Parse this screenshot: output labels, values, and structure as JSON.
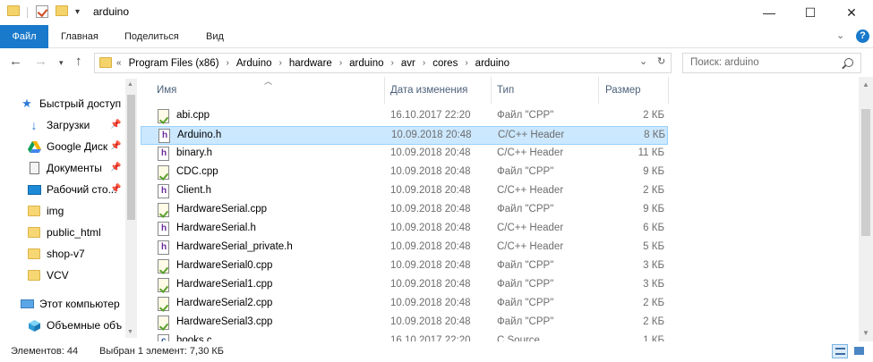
{
  "window": {
    "title": "arduino",
    "controls": {
      "minimize": "—",
      "maximize": "☐",
      "close": "✕"
    }
  },
  "ribbon": {
    "tabs": [
      "Файл",
      "Главная",
      "Поделиться",
      "Вид"
    ]
  },
  "address": {
    "overflow": "«",
    "crumbs": [
      "Program Files (x86)",
      "Arduino",
      "hardware",
      "arduino",
      "avr",
      "cores",
      "arduino"
    ]
  },
  "search": {
    "placeholder": "Поиск: arduino"
  },
  "navpane": {
    "items": [
      {
        "label": "Быстрый доступ",
        "icon": "star-icon",
        "pinned": false
      },
      {
        "label": "Загрузки",
        "icon": "download-icon",
        "pinned": true
      },
      {
        "label": "Google Диск",
        "icon": "google-drive-icon",
        "pinned": true
      },
      {
        "label": "Документы",
        "icon": "documents-icon",
        "pinned": true
      },
      {
        "label": "Рабочий сто...",
        "icon": "desktop-icon",
        "pinned": true
      },
      {
        "label": "img",
        "icon": "folder-icon",
        "pinned": false
      },
      {
        "label": "public_html",
        "icon": "folder-icon",
        "pinned": false
      },
      {
        "label": "shop-v7",
        "icon": "folder-icon",
        "pinned": false
      },
      {
        "label": "VCV",
        "icon": "folder-icon",
        "pinned": false
      },
      {
        "label": "Этот компьютер",
        "icon": "computer-icon",
        "pinned": false
      },
      {
        "label": "Объемные объ",
        "icon": "3d-objects-icon",
        "pinned": false
      }
    ]
  },
  "columns": {
    "name": "Имя",
    "date": "Дата изменения",
    "type": "Тип",
    "size": "Размер"
  },
  "files": [
    {
      "name": "abi.cpp",
      "date": "16.10.2017 22:20",
      "type": "Файл \"CPP\"",
      "size": "2 КБ",
      "kind": "cpp"
    },
    {
      "name": "Arduino.h",
      "date": "10.09.2018 20:48",
      "type": "C/C++ Header",
      "size": "8 КБ",
      "kind": "h"
    },
    {
      "name": "binary.h",
      "date": "10.09.2018 20:48",
      "type": "C/C++ Header",
      "size": "11 КБ",
      "kind": "h"
    },
    {
      "name": "CDC.cpp",
      "date": "10.09.2018 20:48",
      "type": "Файл \"CPP\"",
      "size": "9 КБ",
      "kind": "cpp"
    },
    {
      "name": "Client.h",
      "date": "10.09.2018 20:48",
      "type": "C/C++ Header",
      "size": "2 КБ",
      "kind": "h"
    },
    {
      "name": "HardwareSerial.cpp",
      "date": "10.09.2018 20:48",
      "type": "Файл \"CPP\"",
      "size": "9 КБ",
      "kind": "cpp"
    },
    {
      "name": "HardwareSerial.h",
      "date": "10.09.2018 20:48",
      "type": "C/C++ Header",
      "size": "6 КБ",
      "kind": "h"
    },
    {
      "name": "HardwareSerial_private.h",
      "date": "10.09.2018 20:48",
      "type": "C/C++ Header",
      "size": "5 КБ",
      "kind": "h"
    },
    {
      "name": "HardwareSerial0.cpp",
      "date": "10.09.2018 20:48",
      "type": "Файл \"CPP\"",
      "size": "3 КБ",
      "kind": "cpp"
    },
    {
      "name": "HardwareSerial1.cpp",
      "date": "10.09.2018 20:48",
      "type": "Файл \"CPP\"",
      "size": "3 КБ",
      "kind": "cpp"
    },
    {
      "name": "HardwareSerial2.cpp",
      "date": "10.09.2018 20:48",
      "type": "Файл \"CPP\"",
      "size": "2 КБ",
      "kind": "cpp"
    },
    {
      "name": "HardwareSerial3.cpp",
      "date": "10.09.2018 20:48",
      "type": "Файл \"CPP\"",
      "size": "2 КБ",
      "kind": "cpp"
    },
    {
      "name": "hooks.c",
      "date": "16.10.2017 22:20",
      "type": "C Source",
      "size": "1 КБ",
      "kind": "c"
    }
  ],
  "selected_index": 1,
  "status": {
    "count": "Элементов: 44",
    "selection": "Выбран 1 элемент: 7,30 КБ"
  },
  "colors": {
    "accent": "#1979ca",
    "selection": "#cce8ff"
  }
}
